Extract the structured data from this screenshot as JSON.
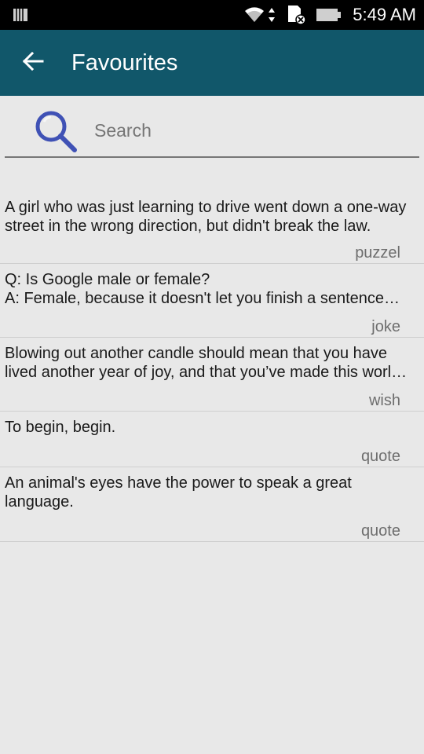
{
  "status_bar": {
    "time": "5:49 AM",
    "icons": [
      "notification-icon",
      "wifi-icon",
      "data-arrows-icon",
      "sd-card-icon",
      "battery-icon"
    ]
  },
  "app_bar": {
    "title": "Favourites",
    "back_icon": "arrow-back-icon",
    "color": "#11576a"
  },
  "search": {
    "placeholder": "Search",
    "value": "",
    "icon": "search-icon",
    "icon_color": "#3f51b5"
  },
  "items": [
    {
      "text": "A girl who was just learning to drive went down a one-way street in the wrong direction, but didn't break the law.",
      "category": "puzzel"
    },
    {
      "text": "Q: Is Google male or female?\nA: Female, because it doesn't let you finish a sentence before making a suggestion.",
      "category": "joke"
    },
    {
      "text": "Blowing out another candle should mean that you have lived another year of joy, and that you’ve made this world a better place.",
      "category": "wish"
    },
    {
      "text": "To begin, begin.",
      "category": "quote"
    },
    {
      "text": "An animal's eyes have the power to speak a great language.",
      "category": "quote"
    }
  ]
}
